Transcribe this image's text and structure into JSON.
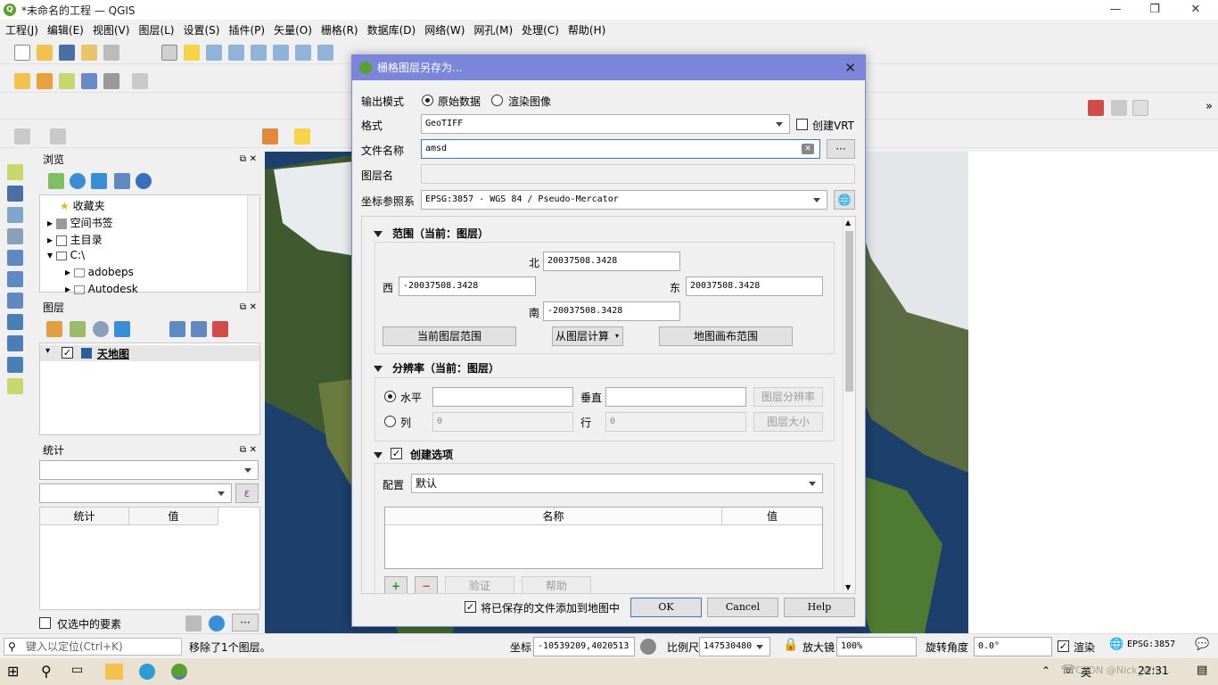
{
  "window": {
    "title": "*未命名的工程 — QGIS"
  },
  "menubar": [
    "工程(J)",
    "编辑(E)",
    "视图(V)",
    "图层(L)",
    "设置(S)",
    "插件(P)",
    "矢量(O)",
    "栅格(R)",
    "数据库(D)",
    "网络(W)",
    "网孔(M)",
    "处理(C)",
    "帮助(H)"
  ],
  "browser": {
    "title": "浏览",
    "items": [
      "收藏夹",
      "空间书签",
      "主目录",
      "C:\\",
      "adobeps",
      "Autodesk"
    ]
  },
  "layers": {
    "title": "图层",
    "items": [
      {
        "label": "天地图",
        "checked": true
      }
    ]
  },
  "stats": {
    "title": "统计",
    "col_stat": "统计",
    "col_value": "值",
    "selected_only": "仅选中的要素"
  },
  "dialog": {
    "title": "栅格图层另存为...",
    "output_mode_label": "输出模式",
    "mode_raw": "原始数据",
    "mode_rendered": "渲染图像",
    "format_label": "格式",
    "format_value": "GeoTIFF",
    "create_vrt": "创建VRT",
    "filename_label": "文件名称",
    "filename_value": "amsd",
    "browse_btn": "···",
    "layername_label": "图层名",
    "crs_label": "坐标参照系",
    "crs_value": "EPSG:3857 - WGS 84 / Pseudo-Mercator",
    "extent": {
      "title": "范围（当前：图层）",
      "north_label": "北",
      "north": "20037508.3428",
      "west_label": "西",
      "west": "-20037508.3428",
      "east_label": "东",
      "east": "20037508.3428",
      "south_label": "南",
      "south": "-20037508.3428",
      "btn_current_layer": "当前图层范围",
      "btn_calc_from_layer": "从图层计算",
      "btn_canvas": "地图画布范围"
    },
    "resolution": {
      "title": "分辨率（当前：图层）",
      "horizontal_label": "水平",
      "vertical_label": "垂直",
      "btn_layer_res": "图层分辨率",
      "cols_label": "列",
      "cols_value": "0",
      "rows_label": "行",
      "rows_value": "0",
      "btn_layer_size": "图层大小"
    },
    "create_options": {
      "title": "创建选项",
      "profile_label": "配置",
      "profile_value": "默认",
      "col_name": "名称",
      "col_value": "值",
      "btn_validate": "验证",
      "btn_help": "帮助"
    },
    "add_to_map": "将已保存的文件添加到地图中",
    "ok": "OK",
    "cancel": "Cancel",
    "help": "Help"
  },
  "statusbar": {
    "locate_placeholder": "键入以定位(Ctrl+K)",
    "message": "移除了1个图层。",
    "coord_label": "坐标",
    "coord_value": "-10539209,4020513",
    "scale_label": "比例尺",
    "scale_value": "147530480",
    "magnifier_label": "放大镜",
    "magnifier_value": "100%",
    "rotation_label": "旋转角度",
    "rotation_value": "0.0°",
    "render_label": "渲染",
    "epsg": "EPSG:3857"
  },
  "taskbar": {
    "lang": "英",
    "time": "22:31",
    "watermark": "CSDN @Nick_Whi..."
  },
  "colors": {
    "dialog_title": "#7b86db",
    "qgis_green": "#5aa02c",
    "map_ocean": "#1d3f6b"
  }
}
